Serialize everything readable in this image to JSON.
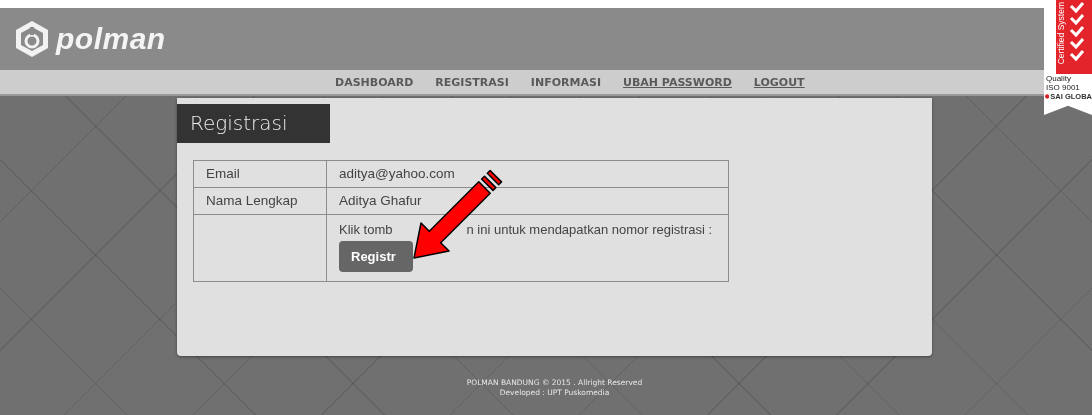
{
  "header": {
    "logo_text": "polman"
  },
  "badge": {
    "vertical_text": "Certified System",
    "lines": [
      "Quality",
      "ISO 9001"
    ],
    "org": "SAI GLOBA"
  },
  "nav": [
    {
      "label": "DASHBOARD",
      "underlined": false
    },
    {
      "label": "REGISTRASI",
      "underlined": false
    },
    {
      "label": "INFORMASI",
      "underlined": false
    },
    {
      "label": "UBAH PASSWORD",
      "underlined": true
    },
    {
      "label": "LOGOUT",
      "underlined": true
    }
  ],
  "card": {
    "title": "Registrasi",
    "rows": [
      {
        "kind": "text",
        "label": "Email",
        "value": "aditya@yahoo.com"
      },
      {
        "kind": "text",
        "label": "Nama Lengkap",
        "value": "Aditya Ghafur"
      },
      {
        "kind": "action",
        "label": "",
        "value_parts": [
          "Klik tomb",
          "n ini untuk mendapatkan nomor registrasi :"
        ],
        "button": "Registr"
      }
    ]
  },
  "annotation": {
    "kind": "arrow"
  },
  "footer": [
    "POLMAN BANDUNG © 2015 . Allright Reserved",
    "Developed : UPT Puskomedia"
  ]
}
